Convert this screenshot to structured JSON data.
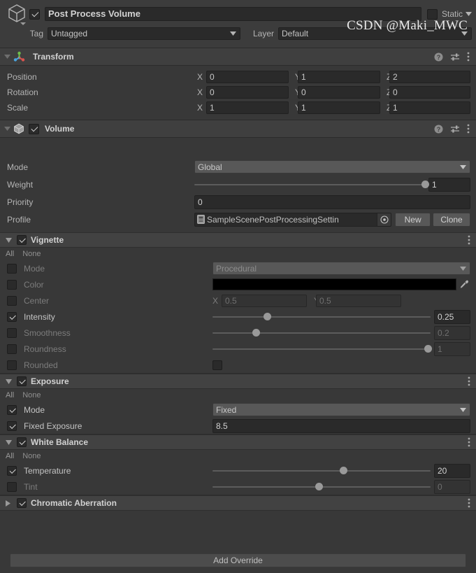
{
  "gameobject": {
    "icon": "cube-icon",
    "enabled": true,
    "name": "Post Process Volume",
    "static_checked": false,
    "static_label": "Static",
    "tag_label": "Tag",
    "tag_value": "Untagged",
    "layer_label": "Layer",
    "layer_value": "Default"
  },
  "transform": {
    "title": "Transform",
    "expanded": true,
    "rows": [
      {
        "label": "Position",
        "x": "0",
        "y": "1",
        "z": "2"
      },
      {
        "label": "Rotation",
        "x": "0",
        "y": "0",
        "z": "0"
      },
      {
        "label": "Scale",
        "x": "1",
        "y": "1",
        "z": "1"
      }
    ],
    "axis_labels": {
      "x": "X",
      "y": "Y",
      "z": "Z"
    }
  },
  "volume": {
    "title": "Volume",
    "enabled": true,
    "expanded": true,
    "mode_label": "Mode",
    "mode_value": "Global",
    "weight_label": "Weight",
    "weight_value": "1",
    "weight_pct": 100,
    "priority_label": "Priority",
    "priority_value": "0",
    "profile_label": "Profile",
    "profile_value": "SampleScenePostProcessingSettin",
    "new_label": "New",
    "clone_label": "Clone"
  },
  "overrides": {
    "all_label": "All",
    "none_label": "None",
    "sections": [
      {
        "title": "Vignette",
        "expanded": true,
        "enabled": true,
        "rows": [
          {
            "name": "Mode",
            "type": "dropdown",
            "override": false,
            "value": "Procedural"
          },
          {
            "name": "Color",
            "type": "color",
            "override": false,
            "value": "#000000"
          },
          {
            "name": "Center",
            "type": "vector2",
            "override": false,
            "x": "0.5",
            "y": "0.5",
            "x_label": "X",
            "y_label": "Y"
          },
          {
            "name": "Intensity",
            "type": "slider",
            "override": true,
            "value": "0.25",
            "pct": 25
          },
          {
            "name": "Smoothness",
            "type": "slider",
            "override": false,
            "value": "0.2",
            "pct": 20
          },
          {
            "name": "Roundness",
            "type": "slider",
            "override": false,
            "value": "1",
            "pct": 99
          },
          {
            "name": "Rounded",
            "type": "checkbox",
            "override": false,
            "checked": false
          }
        ]
      },
      {
        "title": "Exposure",
        "expanded": true,
        "enabled": true,
        "rows": [
          {
            "name": "Mode",
            "type": "dropdown",
            "override": true,
            "value": "Fixed"
          },
          {
            "name": "Fixed Exposure",
            "type": "text",
            "override": true,
            "value": "8.5"
          }
        ]
      },
      {
        "title": "White Balance",
        "expanded": true,
        "enabled": true,
        "rows": [
          {
            "name": "Temperature",
            "type": "slider",
            "override": true,
            "value": "20",
            "pct": 60
          },
          {
            "name": "Tint",
            "type": "slider",
            "override": false,
            "value": "0",
            "pct": 49
          }
        ]
      },
      {
        "title": "Chromatic Aberration",
        "expanded": false,
        "enabled": true,
        "rows": []
      }
    ]
  },
  "footer": {
    "add_override_label": "Add Override",
    "watermark": "CSDN @Maki_MWC"
  },
  "colors": {
    "window_bg": "#383838",
    "header_bg": "#3c3c3c",
    "component_header_bg": "#3f3f3f",
    "field_bg": "#2a2a2a",
    "button_bg": "#585858",
    "text": "#c4c4c4",
    "text_dim": "#7c7c7c"
  }
}
